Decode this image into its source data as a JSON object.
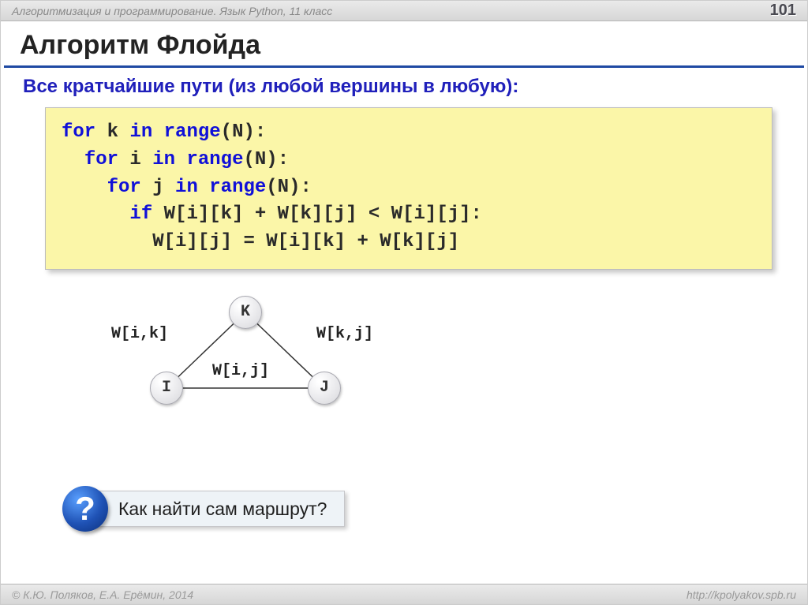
{
  "header": {
    "breadcrumb": "Алгоритмизация и программирование. Язык Python, 11 класс",
    "page_number": "101"
  },
  "slide": {
    "title": "Алгоритм Флойда",
    "subtitle": "Все кратчайшие пути (из любой вершины в  любую):"
  },
  "code": {
    "l1_kw1": "for",
    "l1_txt1": " k ",
    "l1_kw2": "in",
    "l1_txt2": " ",
    "l1_kw3": "range",
    "l1_txt3": "(N):",
    "l2_kw1": "for",
    "l2_txt1": " i ",
    "l2_kw2": "in",
    "l2_txt2": " ",
    "l2_kw3": "range",
    "l2_txt3": "(N):",
    "l3_kw1": "for",
    "l3_txt1": " j ",
    "l3_kw2": "in",
    "l3_txt2": " ",
    "l3_kw3": "range",
    "l3_txt3": "(N):",
    "l4_kw1": "if",
    "l4_txt1": " W[i][k] + W[k][j] < W[i][j]:",
    "l5_txt1": "W[i][j] = W[i][k] + W[k][j]",
    "ind1": "  ",
    "ind2": "    ",
    "ind3": "      ",
    "ind4": "        "
  },
  "diagram": {
    "node_k": "K",
    "node_i": "I",
    "node_j": "J",
    "edge_ik": "W[i,k]",
    "edge_kj": "W[k,j]",
    "edge_ij": "W[i,j]"
  },
  "question": {
    "badge": "?",
    "text": "Как найти сам маршрут?"
  },
  "footer": {
    "left": "© К.Ю. Поляков, Е.А. Ерёмин, 2014",
    "right": "http://kpolyakov.spb.ru"
  }
}
